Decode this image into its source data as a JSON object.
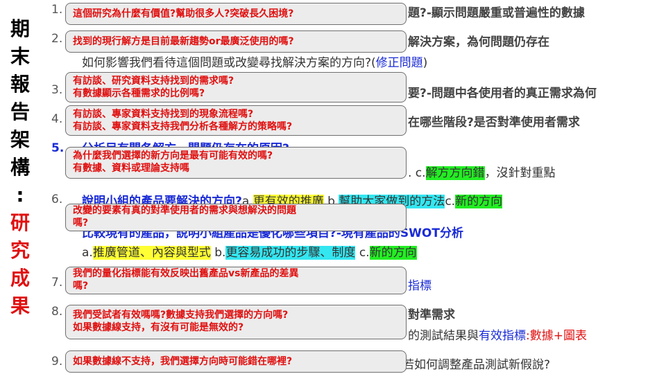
{
  "sidebar": {
    "title_chars": [
      "期",
      "末",
      "報",
      "告",
      "架",
      "構",
      ":"
    ],
    "subtitle_chars": [
      "研",
      "究",
      "成",
      "果"
    ]
  },
  "items": [
    {
      "num": "1.",
      "text": "題?-顯示問題嚴重或普遍性的數據"
    },
    {
      "num": "2.",
      "text": "解決方案，為何問題仍存在",
      "sub_pre": "如何影響我們看待這個問題或改變尋找解決方案的方向?(",
      "sub_link": "修正問題",
      "sub_post": ")"
    },
    {
      "num": "3.",
      "text": "要?-問題中各使用者的真正需求為何"
    },
    {
      "num": "4.",
      "text": "在哪些階段?是否對準使用者需求"
    },
    {
      "num": "5.",
      "text": "分析目有問各解方，問題仍存在的原因?",
      "sub_pre": ". c.",
      "sub_hl": "解方方向錯",
      "sub_post": "，沒針對重點"
    },
    {
      "num": "6.",
      "title": "說明小組的產品要解決的方向?",
      "a": "a.",
      "a_hl": "更有效的推廣",
      "b": " b.",
      "b_hl": "幫助大家做到的方法",
      "c": "c.",
      "c_hl": "新的方向",
      "line2": "比較現有的產品，說明小組產品是優化哪些項目?-現有產品的SWOT分析",
      "line3_a": "a.",
      "line3_a_hl": "推廣管道、內容與型式",
      "line3_b": "  b.",
      "line3_b_hl": "更容易成功的步驟、制度",
      "line3_c": "  c.",
      "line3_c_hl": "新的方向"
    },
    {
      "num": "7.",
      "text": "指標"
    },
    {
      "num": "8.",
      "text": "對準需求",
      "sub_pre": "的測試結果與",
      "sub_link": "有效指標",
      "sub_post": ":數據+圖表"
    },
    {
      "num": "9.",
      "text": "若如何調整產品測試新假說?"
    }
  ],
  "callouts": [
    {
      "lines": [
        "這個研究為什麼有價值?幫助很多人?突破長久困境?"
      ]
    },
    {
      "lines": [
        "找到的現行解方是目前最新趨勢or最廣泛使用的嗎?"
      ]
    },
    {
      "lines": [
        "有訪談、研究資料支持找到的需求嗎?",
        "有數據顯示各種需求的比例嗎?"
      ]
    },
    {
      "lines": [
        "有訪談、專家資料支持找到的現象流程嗎?",
        "有訪談、專家資料支持我們分析各種解方的策略嗎?"
      ]
    },
    {
      "lines": [
        "為什麼我們選擇的新方向是最有可能有效的嗎?",
        "有數據、資料或理論支持嗎"
      ]
    },
    {
      "lines": [
        "改變的要素有真的對準使用者的需求與想解決的問題",
        "嗎?"
      ]
    },
    {
      "lines": [
        "我們的量化指標能有效反映出舊產品vs新產品的差異",
        "嗎?"
      ]
    },
    {
      "lines": [
        "我們受試者有效嗎嗎?數據支持我們選擇的方向嗎?",
        "如果數據線支持，有沒有可能是無效的?"
      ]
    },
    {
      "lines": [
        "如果數據線不支持，我們選擇方向時可能錯在哪裡?"
      ]
    }
  ]
}
